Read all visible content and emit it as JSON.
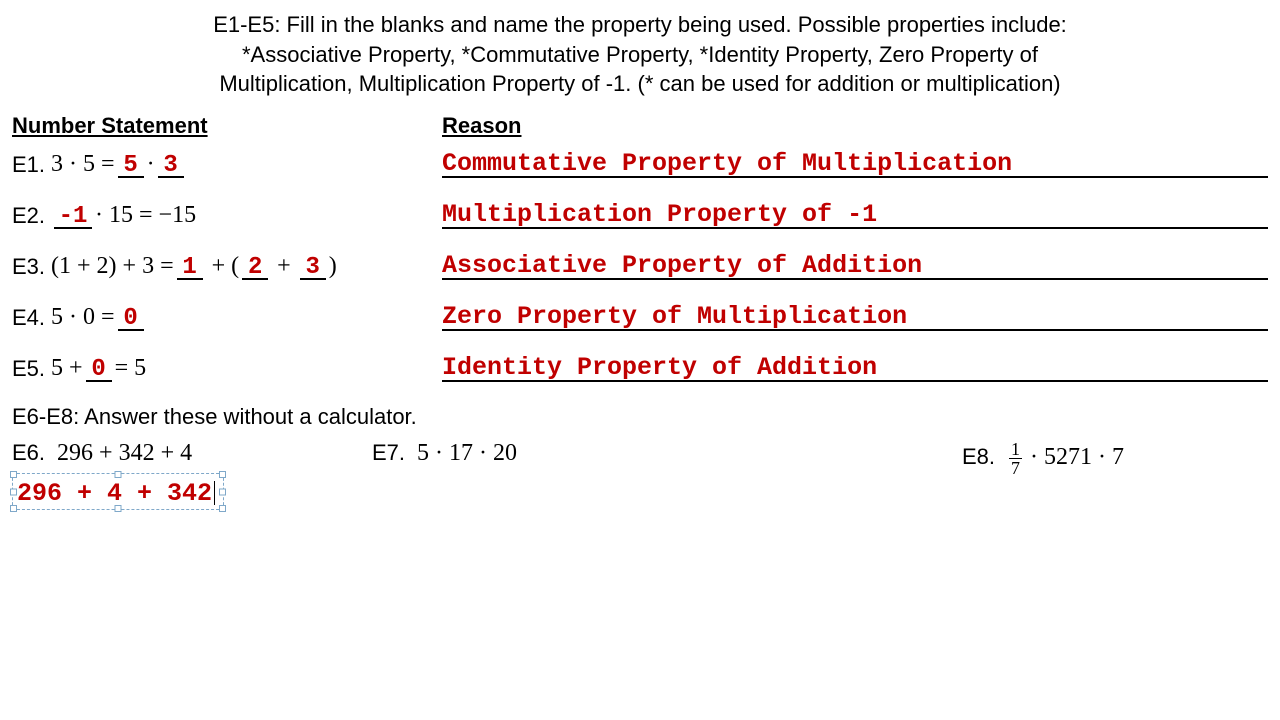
{
  "instructions": {
    "line1": "E1-E5:  Fill in the blanks and name the property being used.  Possible properties include:",
    "line2": "*Associative Property, *Commutative Property, *Identity Property, Zero Property of",
    "line3": "Multiplication, Multiplication Property of -1.  (* can be used for addition or multiplication)"
  },
  "headers": {
    "left": "Number Statement",
    "right": "Reason"
  },
  "rows": [
    {
      "label": "E1.",
      "pre": "3 · 5 = ",
      "blanks": [
        "5",
        "3"
      ],
      "mid": " · ",
      "reason": "Commutative Property of Multiplication"
    },
    {
      "label": "E2.",
      "blank_first": "-1",
      "post": " · 15 = −15",
      "reason": "Multiplication Property of -1"
    },
    {
      "label": "E3.",
      "pre": "(1 + 2) + 3 = ",
      "b1": "1",
      "b2": "2",
      "b3": "3",
      "reason": "Associative Property of Addition"
    },
    {
      "label": "E4.",
      "pre": "5 · 0 = ",
      "b1": "0",
      "reason": "Zero Property of Multiplication"
    },
    {
      "label": "E5.",
      "pre": "5 + ",
      "b1": "0",
      "post": " = 5",
      "reason": "Identity Property of Addition"
    }
  ],
  "section2": "E6-E8:  Answer these without a calculator.",
  "bottom": {
    "e6": {
      "label": "E6.",
      "expr": "296 + 342 + 4",
      "work": "296 + 4 + 342"
    },
    "e7": {
      "label": "E7.",
      "expr": "5 · 17 · 20"
    },
    "e8": {
      "label": "E8.",
      "frac_num": "1",
      "frac_den": "7",
      "rest": " · 5271 · 7"
    }
  }
}
